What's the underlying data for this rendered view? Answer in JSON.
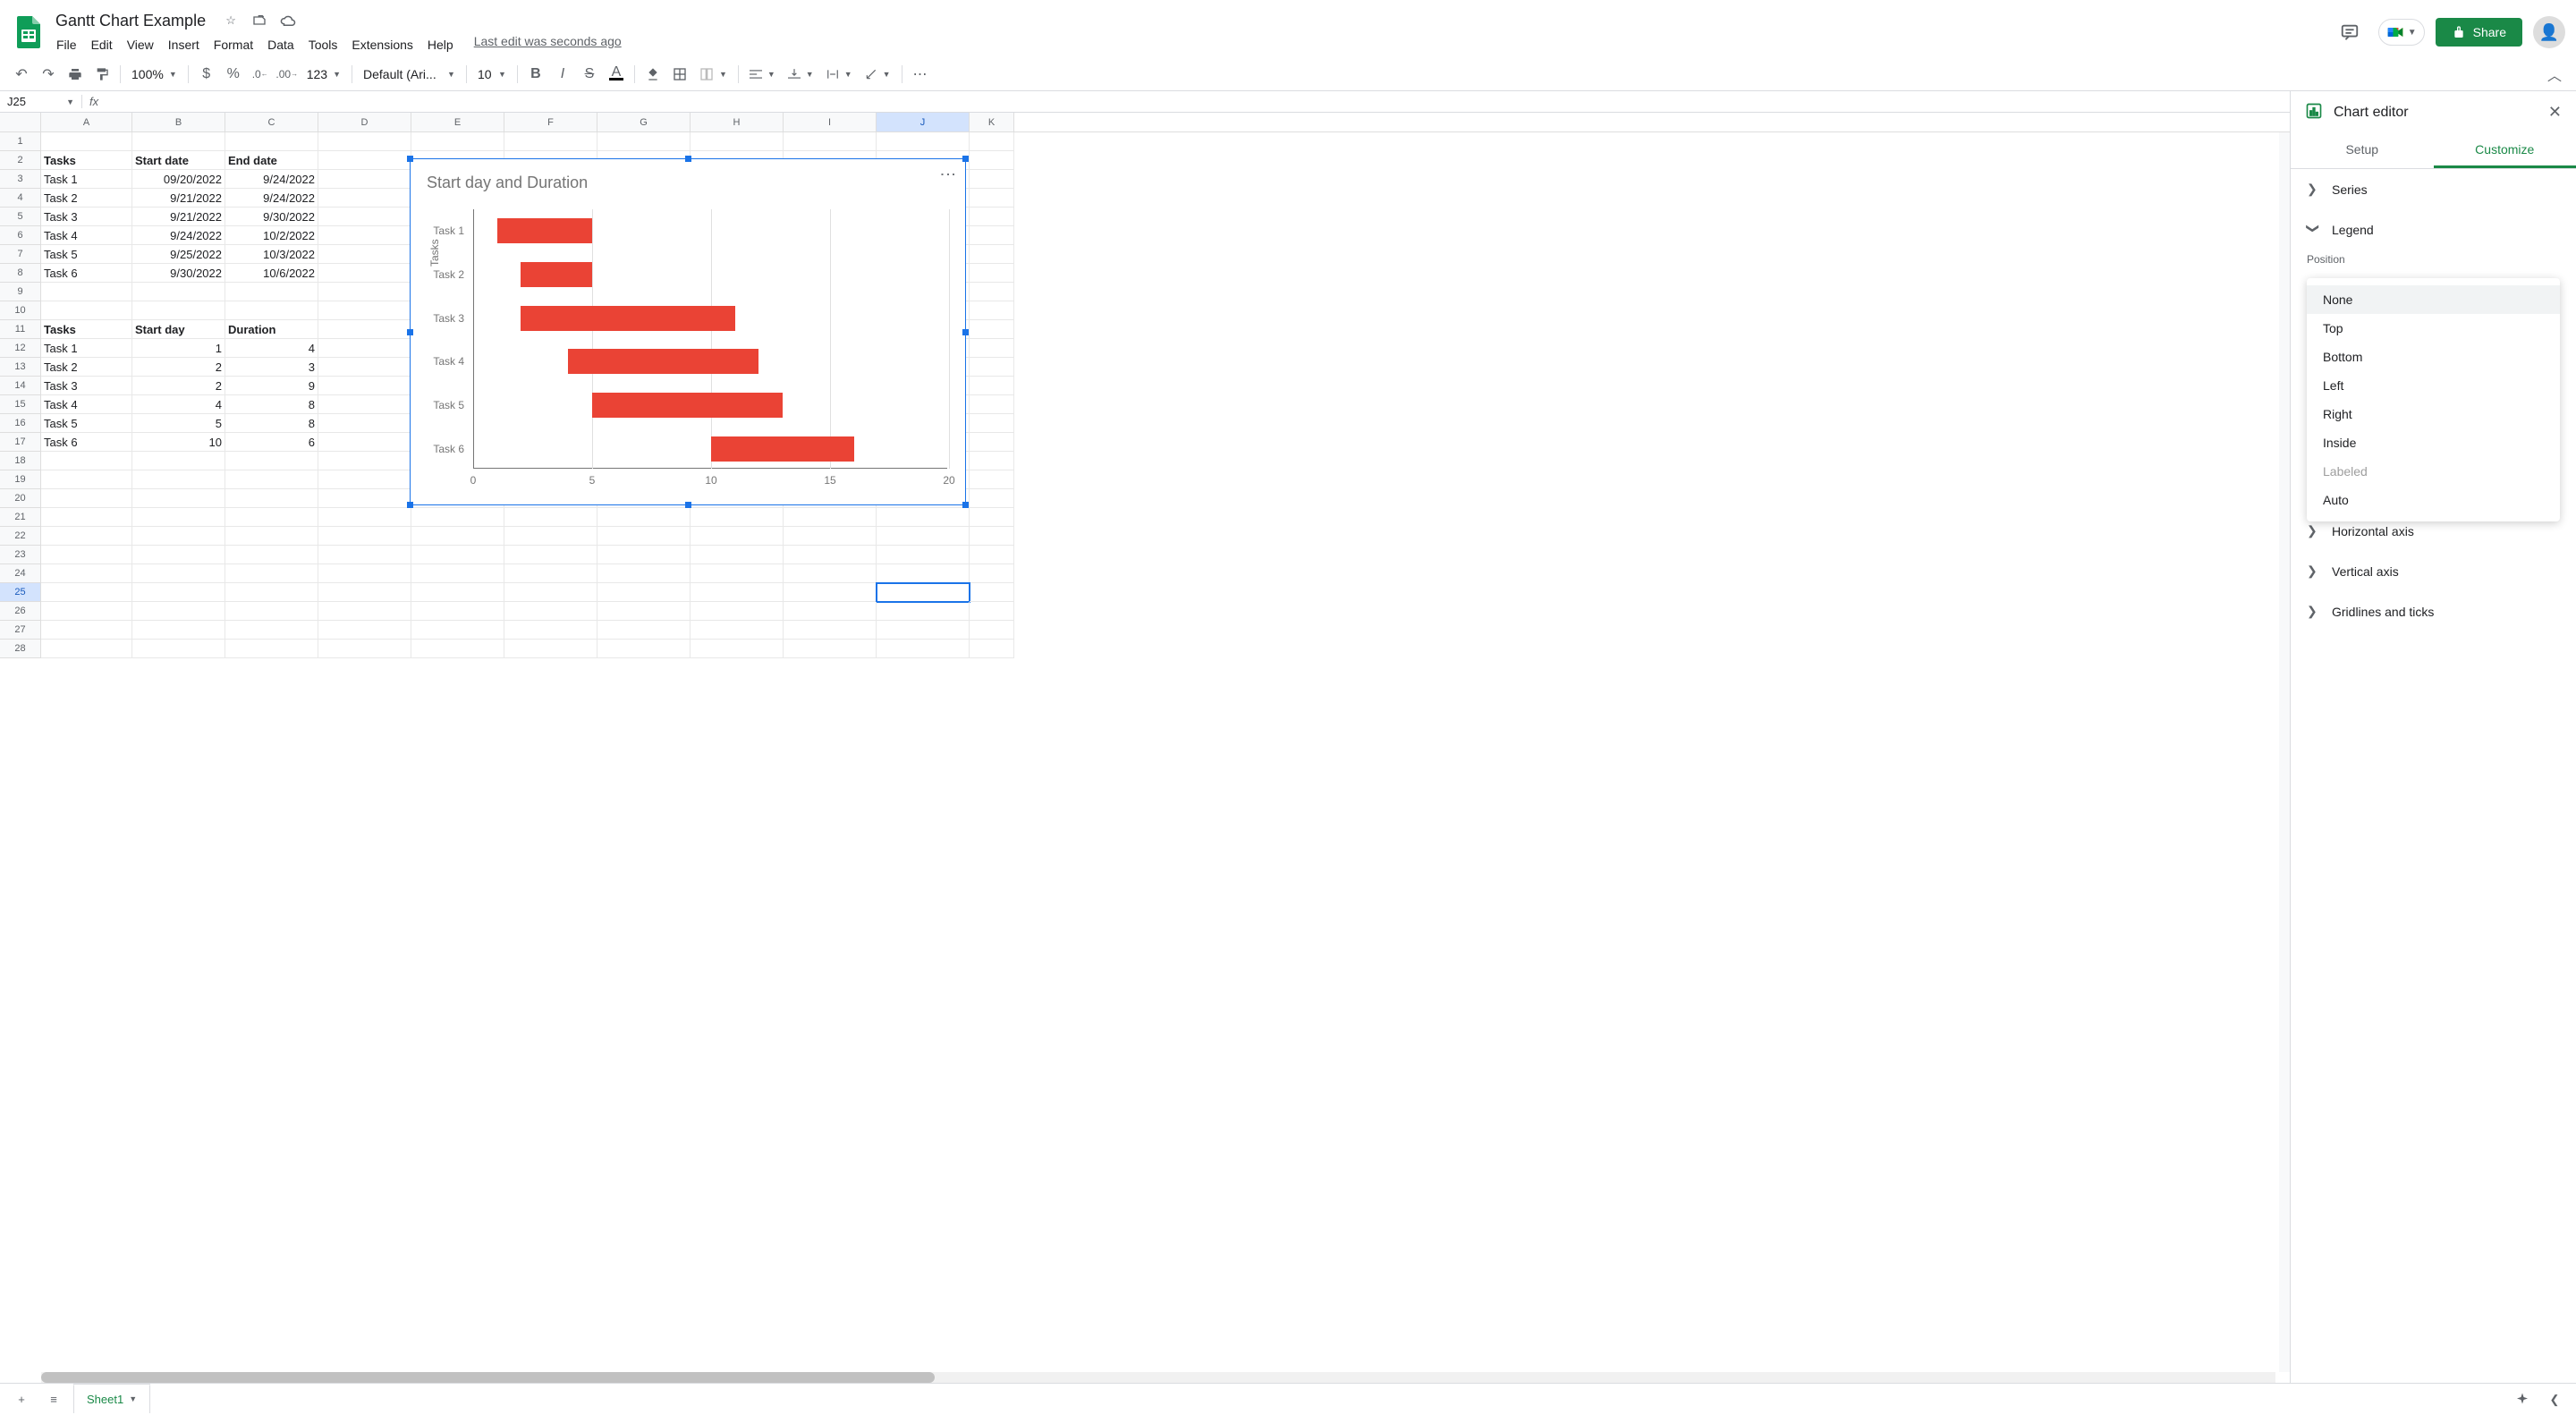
{
  "doc": {
    "title": "Gantt Chart Example",
    "last_edit": "Last edit was seconds ago"
  },
  "menus": [
    "File",
    "Edit",
    "View",
    "Insert",
    "Format",
    "Data",
    "Tools",
    "Extensions",
    "Help"
  ],
  "share_label": "Share",
  "toolbar": {
    "zoom": "100%",
    "font": "Default (Ari...",
    "font_size": "10"
  },
  "name_box": "J25",
  "col_widths": {
    "A": 102,
    "B": 104,
    "C": 104,
    "D": 104,
    "E": 104,
    "F": 104,
    "G": 104,
    "H": 104,
    "I": 104,
    "J": 104,
    "K": 50
  },
  "columns": [
    "A",
    "B",
    "C",
    "D",
    "E",
    "F",
    "G",
    "H",
    "I",
    "J",
    "K"
  ],
  "rows": {
    "2": {
      "A": "Tasks",
      "B": "Start date",
      "C": "End date"
    },
    "3": {
      "A": "Task 1",
      "B": "09/20/2022",
      "C": "9/24/2022"
    },
    "4": {
      "A": "Task 2",
      "B": "9/21/2022",
      "C": "9/24/2022"
    },
    "5": {
      "A": "Task 3",
      "B": "9/21/2022",
      "C": "9/30/2022"
    },
    "6": {
      "A": "Task 4",
      "B": "9/24/2022",
      "C": "10/2/2022"
    },
    "7": {
      "A": "Task 5",
      "B": "9/25/2022",
      "C": "10/3/2022"
    },
    "8": {
      "A": "Task 6",
      "B": "9/30/2022",
      "C": "10/6/2022"
    },
    "11": {
      "A": "Tasks",
      "B": "Start day",
      "C": "Duration"
    },
    "12": {
      "A": "Task 1",
      "B": "1",
      "C": "4"
    },
    "13": {
      "A": "Task 2",
      "B": "2",
      "C": "3"
    },
    "14": {
      "A": "Task 3",
      "B": "2",
      "C": "9"
    },
    "15": {
      "A": "Task 4",
      "B": "4",
      "C": "8"
    },
    "16": {
      "A": "Task 5",
      "B": "5",
      "C": "8"
    },
    "17": {
      "A": "Task 6",
      "B": "10",
      "C": "6"
    }
  },
  "bold_rows": [
    2,
    11
  ],
  "right_align_cols_rows": {
    "B": [
      3,
      4,
      5,
      6,
      7,
      8,
      12,
      13,
      14,
      15,
      16,
      17
    ],
    "C": [
      3,
      4,
      5,
      6,
      7,
      8,
      12,
      13,
      14,
      15,
      16,
      17
    ]
  },
  "selected_cell": {
    "row": 25,
    "col": "J"
  },
  "chart": {
    "title": "Start day and Duration",
    "ylabel": "Tasks"
  },
  "chart_data": {
    "type": "bar",
    "orientation": "horizontal",
    "stacked": true,
    "categories": [
      "Task 1",
      "Task 2",
      "Task 3",
      "Task 4",
      "Task 5",
      "Task 6"
    ],
    "series": [
      {
        "name": "Start day",
        "values": [
          1,
          2,
          2,
          4,
          5,
          10
        ],
        "color": "transparent"
      },
      {
        "name": "Duration",
        "values": [
          4,
          3,
          9,
          8,
          8,
          6
        ],
        "color": "#ea4335"
      }
    ],
    "xlim": [
      0,
      20
    ],
    "xticks": [
      0,
      5,
      10,
      15,
      20
    ],
    "title": "Start day and Duration",
    "ylabel": "Tasks"
  },
  "sidebar": {
    "title": "Chart editor",
    "tabs": {
      "setup": "Setup",
      "customize": "Customize"
    },
    "sections": [
      "Series",
      "Legend",
      "Horizontal axis",
      "Vertical axis",
      "Gridlines and ticks"
    ],
    "position_label": "Position",
    "position_options": [
      "None",
      "Top",
      "Bottom",
      "Left",
      "Right",
      "Inside",
      "Labeled",
      "Auto"
    ],
    "position_selected": "None",
    "position_disabled": [
      "Labeled"
    ]
  },
  "sheet_tab": "Sheet1"
}
